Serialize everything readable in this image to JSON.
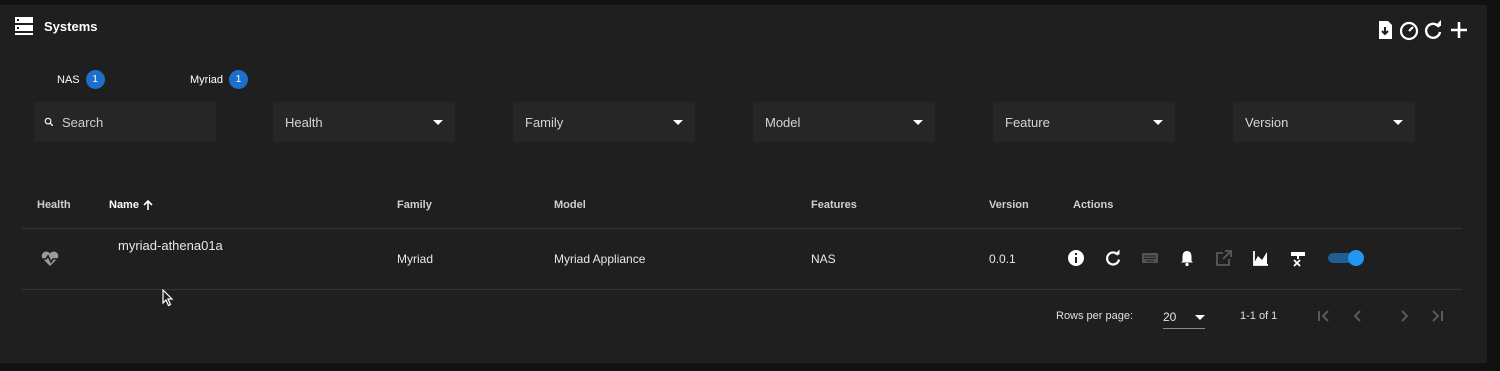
{
  "header": {
    "title": "Systems",
    "icons": [
      "server-icon",
      "download-report-icon",
      "gauge-icon",
      "refresh-icon",
      "add-icon"
    ]
  },
  "tabs": [
    {
      "label": "NAS",
      "count": "1"
    },
    {
      "label": "Myriad",
      "count": "1"
    }
  ],
  "filters": {
    "search_placeholder": "Search",
    "health": "Health",
    "family": "Family",
    "model": "Model",
    "feature": "Feature",
    "version": "Version"
  },
  "table": {
    "columns": {
      "health": "Health",
      "name": "Name",
      "family": "Family",
      "model": "Model",
      "features": "Features",
      "version": "Version",
      "actions": "Actions"
    },
    "rows": [
      {
        "health_icon": "heartbeat-icon",
        "name": "myriad-athena01a",
        "family": "Myriad",
        "model": "Myriad Appliance",
        "features": "NAS",
        "version": "0.0.1",
        "enabled": true
      }
    ]
  },
  "pagination": {
    "rows_per_page_label": "Rows per page:",
    "rows_per_page": "20",
    "range": "1-1 of 1"
  },
  "colors": {
    "accent": "#1e6fcb",
    "toggle": "#2196f3"
  }
}
